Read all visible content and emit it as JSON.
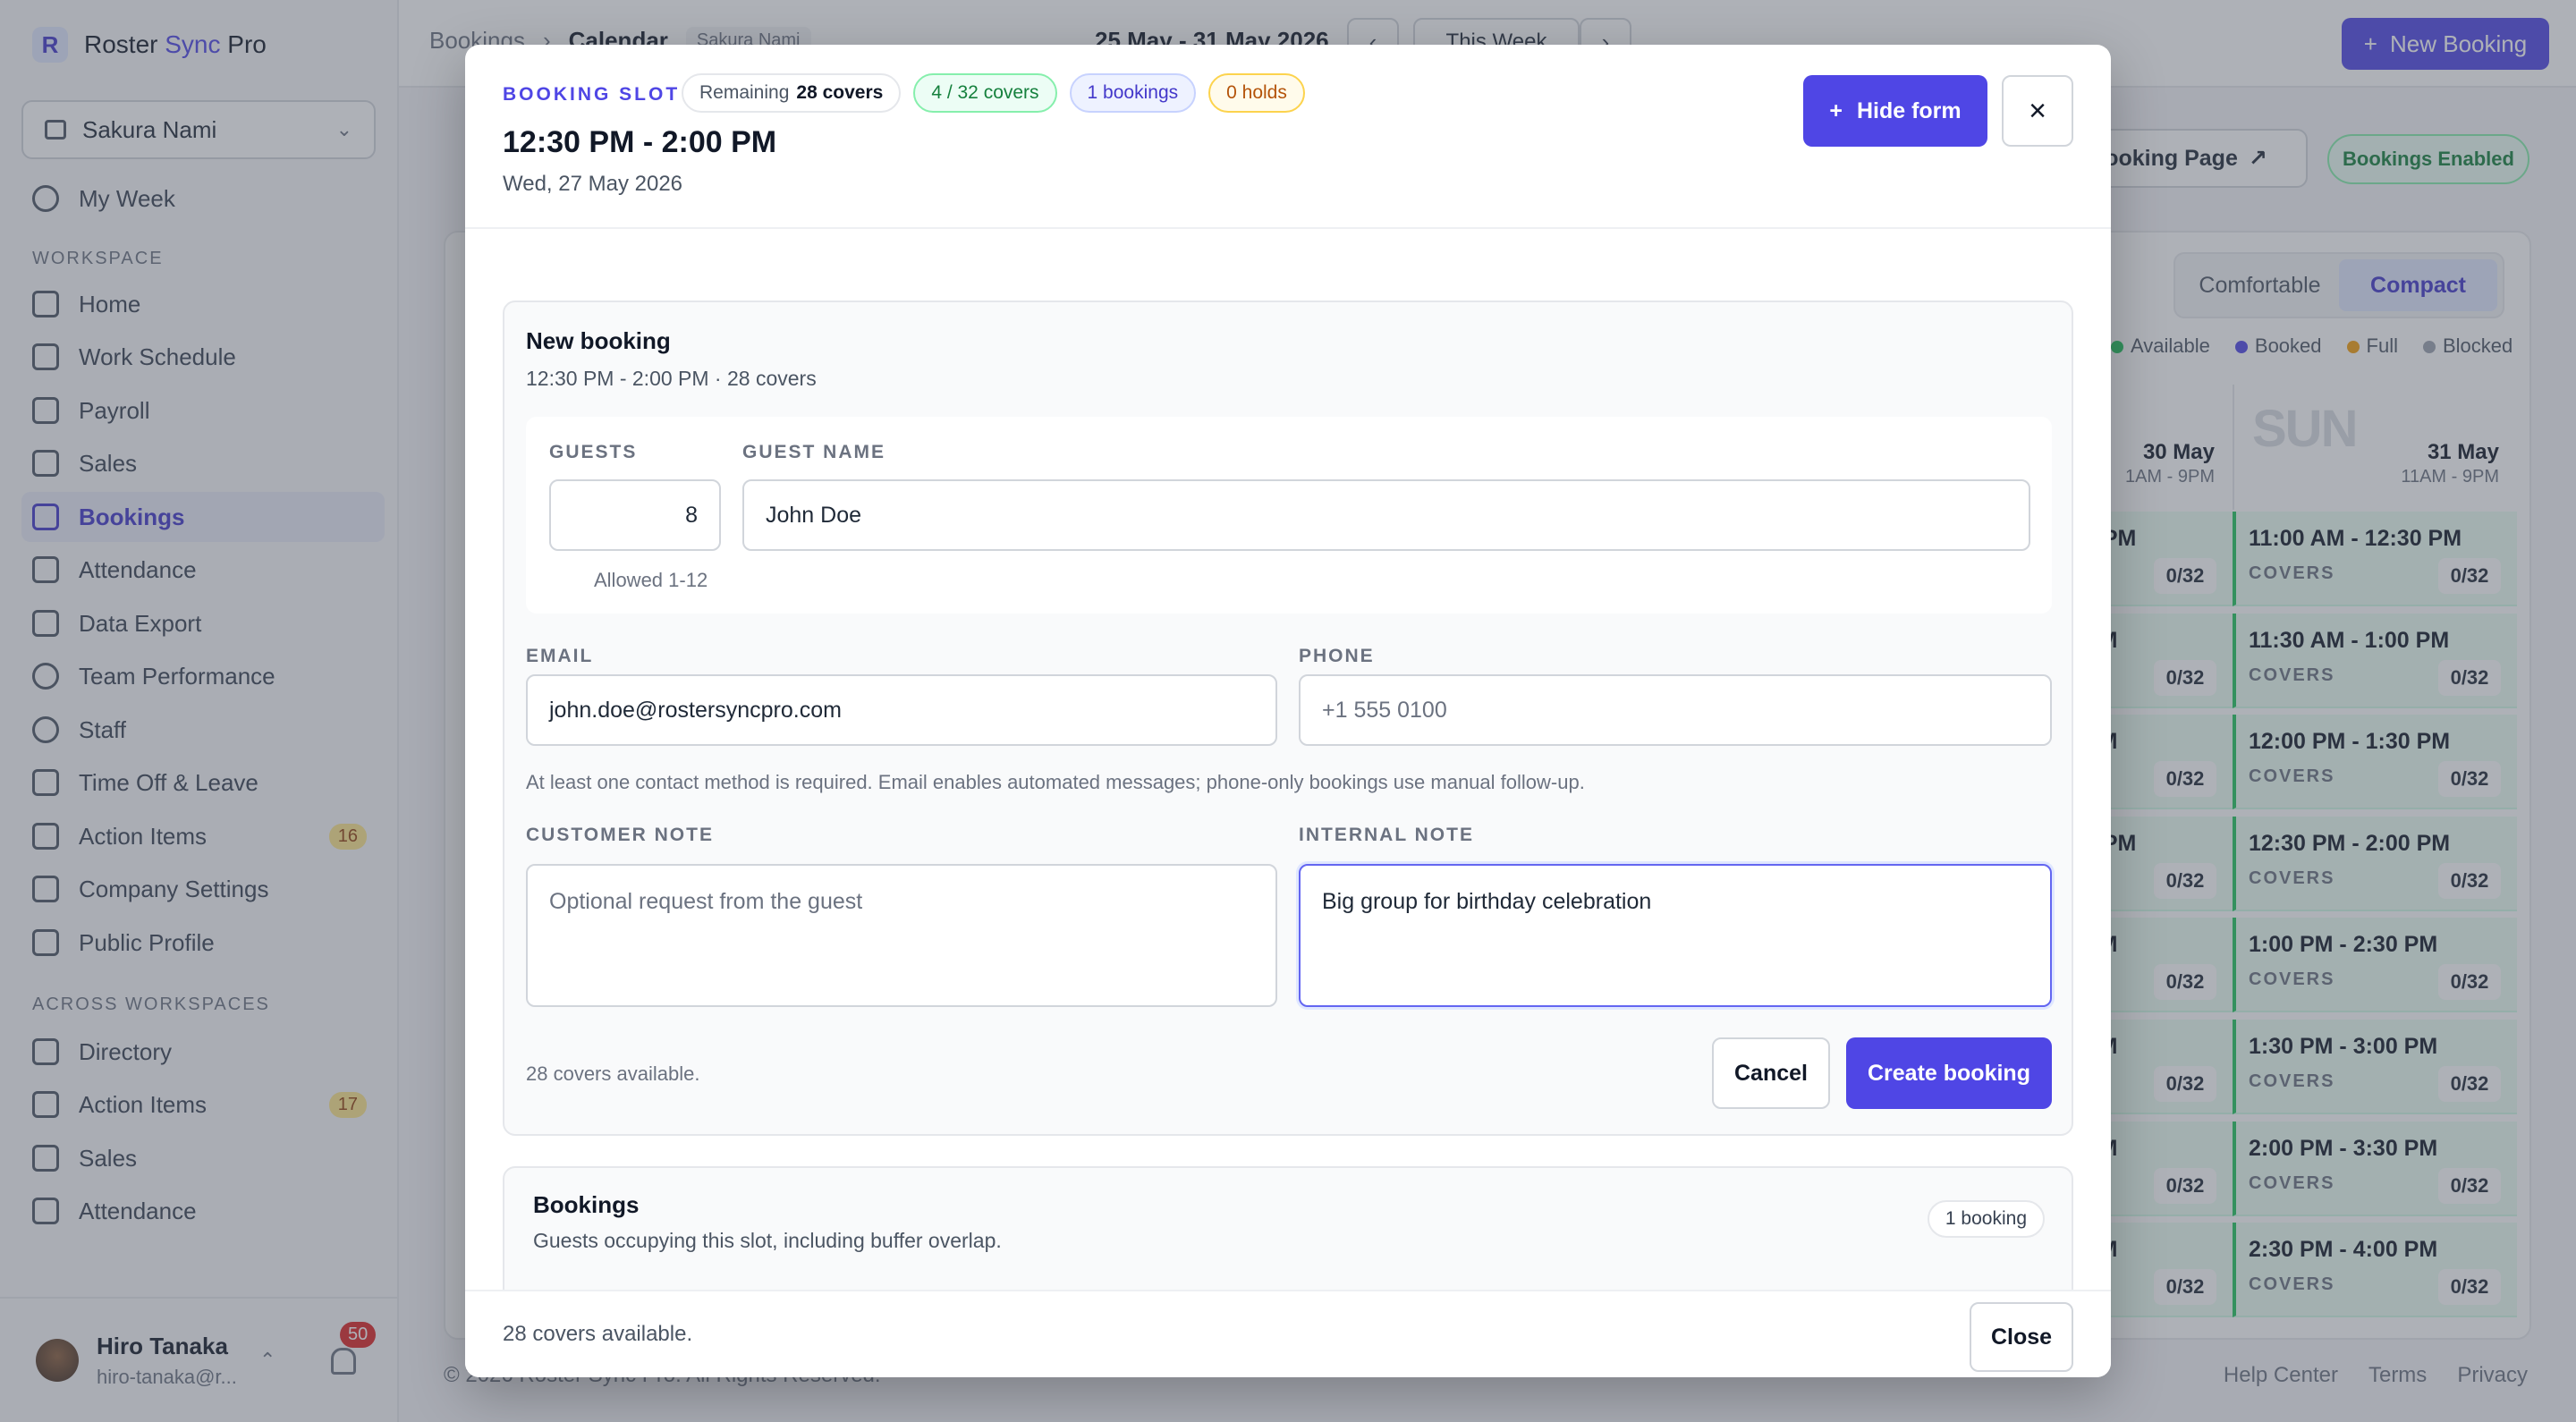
{
  "app": {
    "brand_prefix": "Roster ",
    "brand_sync": "Sync",
    "brand_suffix": " Pro"
  },
  "workspace_select": {
    "value": "Sakura Nami"
  },
  "sidebar": {
    "top_item": "My Week",
    "workspace_label": "WORKSPACE",
    "items": [
      {
        "label": "Home"
      },
      {
        "label": "Work Schedule"
      },
      {
        "label": "Payroll"
      },
      {
        "label": "Sales"
      },
      {
        "label": "Bookings",
        "active": true
      },
      {
        "label": "Attendance"
      },
      {
        "label": "Data Export"
      },
      {
        "label": "Team Performance"
      },
      {
        "label": "Staff"
      },
      {
        "label": "Time Off & Leave"
      },
      {
        "label": "Action Items",
        "count": "16"
      },
      {
        "label": "Company Settings"
      },
      {
        "label": "Public Profile"
      }
    ],
    "across_label": "ACROSS WORKSPACES",
    "across_items": [
      {
        "label": "Directory"
      },
      {
        "label": "Action Items",
        "count": "17"
      },
      {
        "label": "Sales"
      },
      {
        "label": "Attendance"
      }
    ]
  },
  "user": {
    "name": "Hiro Tanaka",
    "email": "hiro-tanaka@r...",
    "notifications": "50"
  },
  "topbar": {
    "crumb_root": "Bookings",
    "crumb_current": "Calendar",
    "crumb_tag": "Sakura Nami",
    "range": "25 May - 31 May 2026",
    "this_week": "This Week",
    "new_booking": "New Booking"
  },
  "page_actions": {
    "booking_page": "Booking Page",
    "bookings_enabled": "Bookings Enabled"
  },
  "density": {
    "comfortable": "Comfortable",
    "compact": "Compact"
  },
  "legend": {
    "available": "Available",
    "booked": "Booked",
    "full": "Full",
    "blocked": "Blocked"
  },
  "columns": [
    {
      "date": "30 May",
      "hours": "1AM - 9PM",
      "big": ""
    },
    {
      "date": "31 May",
      "hours": "11AM - 9PM",
      "big": "SUN"
    }
  ],
  "slots_partial": [
    {
      "time": "0 PM",
      "count": "0/32"
    },
    {
      "time": "PM",
      "count": "0/32"
    },
    {
      "time": "PM",
      "count": "0/32"
    },
    {
      "time": "0 PM",
      "count": "0/32"
    },
    {
      "time": "PM",
      "count": "0/32"
    },
    {
      "time": "PM",
      "count": "0/32"
    },
    {
      "time": "PM",
      "count": "0/32"
    },
    {
      "time": "PM",
      "count": "0/32"
    }
  ],
  "slots_sun": [
    {
      "time": "11:00 AM - 12:30 PM",
      "label": "COVERS",
      "count": "0/32"
    },
    {
      "time": "11:30 AM - 1:00 PM",
      "label": "COVERS",
      "count": "0/32"
    },
    {
      "time": "12:00 PM - 1:30 PM",
      "label": "COVERS",
      "count": "0/32"
    },
    {
      "time": "12:30 PM - 2:00 PM",
      "label": "COVERS",
      "count": "0/32"
    },
    {
      "time": "1:00 PM - 2:30 PM",
      "label": "COVERS",
      "count": "0/32"
    },
    {
      "time": "1:30 PM - 3:00 PM",
      "label": "COVERS",
      "count": "0/32"
    },
    {
      "time": "2:00 PM - 3:30 PM",
      "label": "COVERS",
      "count": "0/32"
    },
    {
      "time": "2:30 PM - 4:00 PM",
      "label": "COVERS",
      "count": "0/32"
    }
  ],
  "footer": {
    "copyright": "© 2026 Roster Sync Pro. All Rights Reserved.",
    "help": "Help Center",
    "terms": "Terms",
    "privacy": "Privacy"
  },
  "modal": {
    "eyebrow": "BOOKING SLOT",
    "remaining_label": "Remaining",
    "remaining_value": "28 covers",
    "covers_chip": "4 / 32 covers",
    "bookings_chip": "1 bookings",
    "holds_chip": "0 holds",
    "title": "12:30 PM - 2:00 PM",
    "date": "Wed, 27 May 2026",
    "hide_form": "Hide form",
    "form": {
      "title": "New booking",
      "subtitle": "12:30 PM - 2:00 PM · 28 covers",
      "guests_label": "GUESTS",
      "guests_value": "8",
      "guests_hint": "Allowed 1-12",
      "name_label": "GUEST NAME",
      "name_value": "John Doe",
      "email_label": "EMAIL",
      "email_value": "john.doe@rostersyncpro.com",
      "phone_label": "PHONE",
      "phone_placeholder": "+1 555 0100",
      "contact_hint": "At least one contact method is required. Email enables automated messages; phone-only bookings use manual follow-up.",
      "customer_note_label": "CUSTOMER NOTE",
      "customer_note_placeholder": "Optional request from the guest",
      "internal_note_label": "INTERNAL NOTE",
      "internal_note_value": "Big group for birthday celebration",
      "availability": "28 covers available.",
      "cancel": "Cancel",
      "create": "Create booking"
    },
    "bookings": {
      "title": "Bookings",
      "subtitle": "Guests occupying this slot, including buffer overlap.",
      "badge": "1 booking"
    },
    "footer_text": "28 covers available.",
    "close": "Close"
  }
}
